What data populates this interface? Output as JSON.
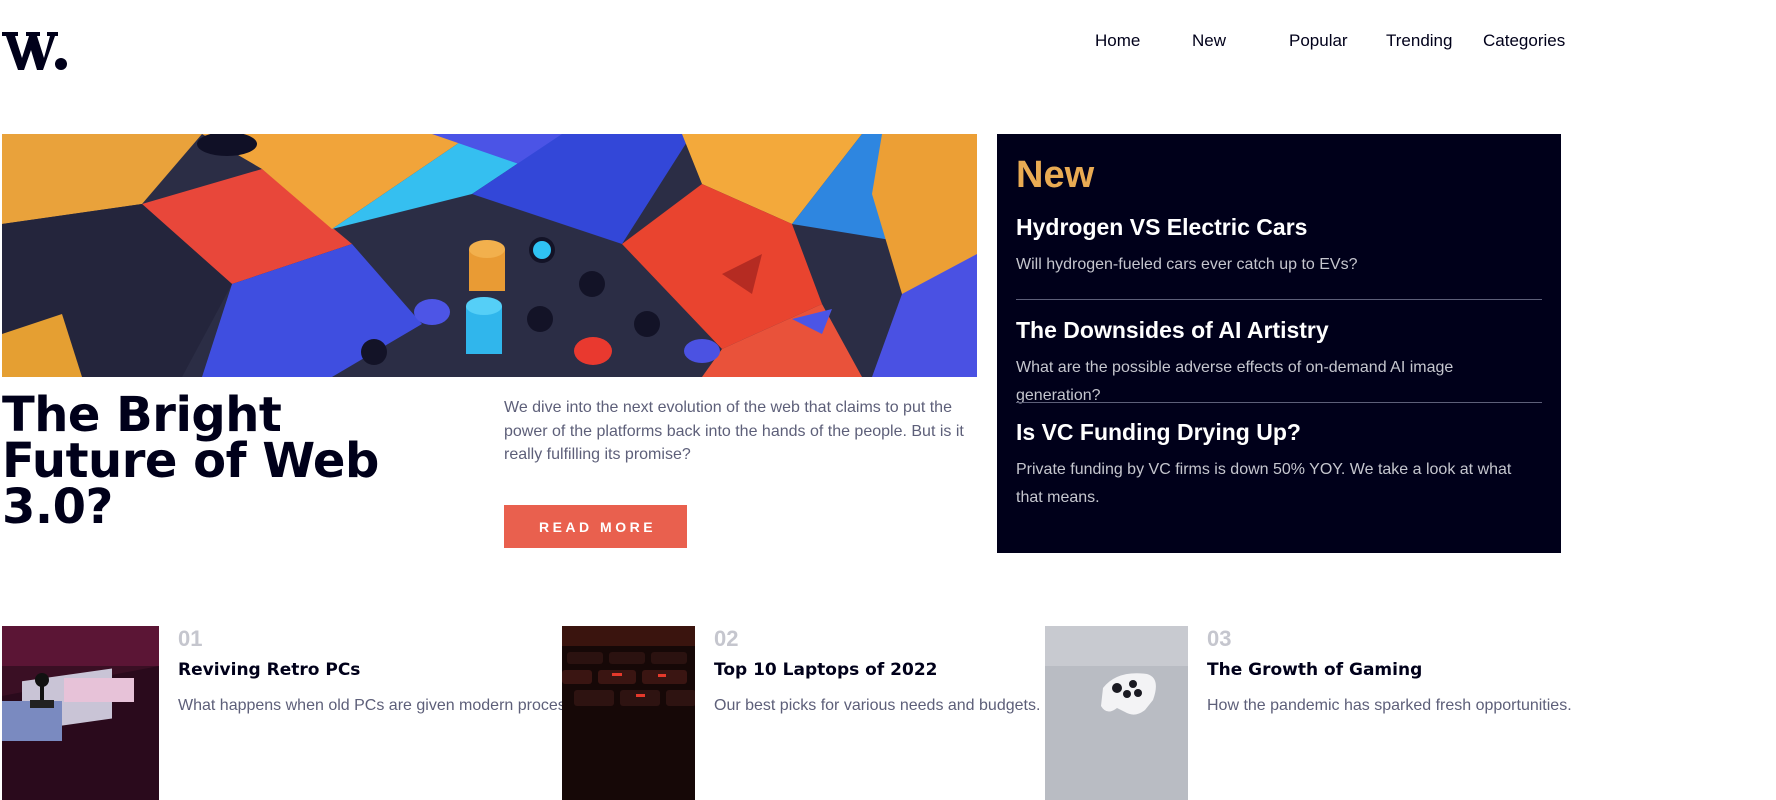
{
  "logo": {
    "text": "W."
  },
  "nav": {
    "items": [
      {
        "label": "Home"
      },
      {
        "label": "New"
      },
      {
        "label": "Popular"
      },
      {
        "label": "Trending"
      },
      {
        "label": "Categories"
      }
    ]
  },
  "hero": {
    "title": "The Bright Future of Web 3.0?",
    "description": "We dive into the next evolution of the web that claims to put the power of the platforms back into the hands of the people. But is it really fulfilling its promise?",
    "button_label": "READ MORE"
  },
  "new_panel": {
    "heading": "New",
    "items": [
      {
        "title": "Hydrogen VS Electric Cars",
        "description": "Will hydrogen-fueled cars ever catch up to EVs?"
      },
      {
        "title": "The Downsides of AI Artistry",
        "description": "What are the possible adverse effects of on-demand AI image generation?"
      },
      {
        "title": "Is VC Funding Drying Up?",
        "description": "Private funding by VC firms is down 50% YOY. We take a look at what that means."
      }
    ]
  },
  "articles": [
    {
      "number": "01",
      "title": "Reviving Retro PCs",
      "description": "What happens when old PCs are given modern processors?"
    },
    {
      "number": "02",
      "title": "Top 10 Laptops of 2022",
      "description": "Our best picks for various needs and budgets."
    },
    {
      "number": "03",
      "title": "The Growth of Gaming",
      "description": "How the pandemic has sparked fresh opportunities."
    }
  ],
  "colors": {
    "dark_navy": "#00001a",
    "accent_red": "#e9604e",
    "accent_orange": "#e9ab53",
    "grayish_blue": "#5d5f79",
    "light_gray": "#c5c6ce"
  }
}
